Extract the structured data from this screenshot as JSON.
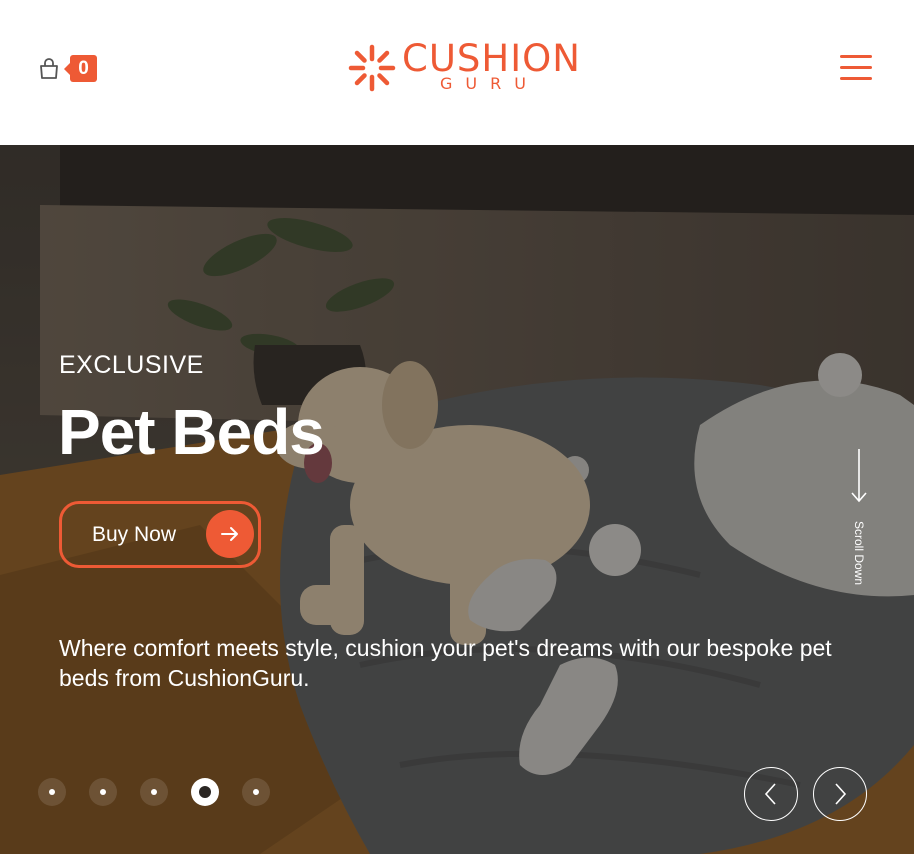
{
  "header": {
    "cart_count": "0",
    "logo": {
      "word": "CUSHION",
      "sub": "GURU"
    }
  },
  "hero": {
    "eyebrow": "EXCLUSIVE",
    "headline": "Pet Beds",
    "cta_label": "Buy Now",
    "description": "Where comfort meets style, cushion your pet's dreams with our bespoke pet beds from CushionGuru.",
    "scroll_label": "Scroll Down",
    "slides": {
      "count": 5,
      "active_index": 3
    }
  },
  "icons": [
    "shopping-bag-icon",
    "hamburger-menu-icon",
    "arrow-right-icon",
    "arrow-down-icon",
    "chevron-left-icon",
    "chevron-right-icon"
  ],
  "colors": {
    "accent": "#ee5a35",
    "overlay": "#2a2623"
  }
}
